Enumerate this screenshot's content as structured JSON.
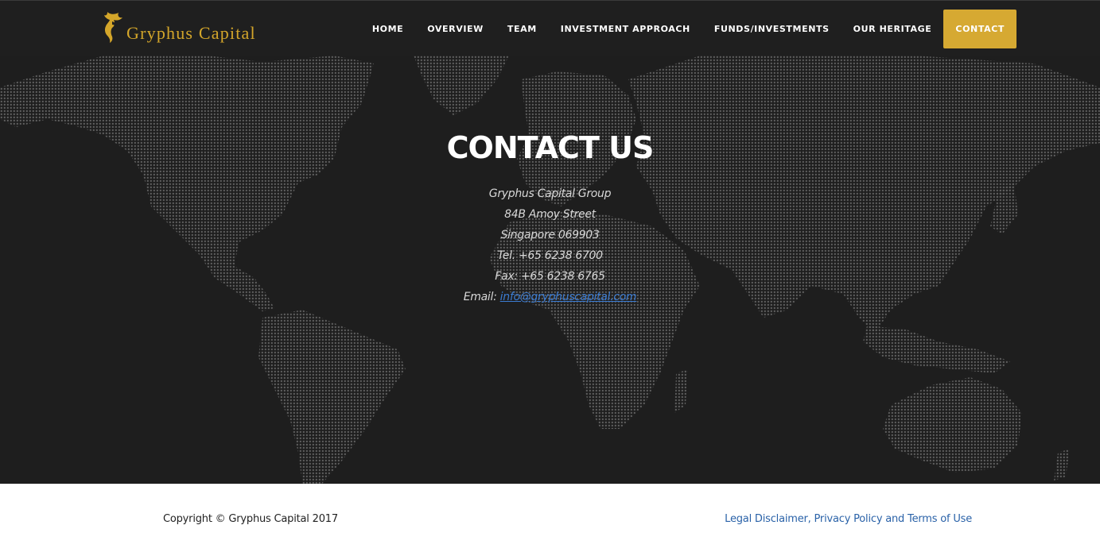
{
  "brand": {
    "name": "Gryphus Capital",
    "color": "#d4a62a"
  },
  "nav": {
    "items": [
      {
        "label": "HOME"
      },
      {
        "label": "OVERVIEW"
      },
      {
        "label": "TEAM"
      },
      {
        "label": "INVESTMENT APPROACH"
      },
      {
        "label": "FUNDS/INVESTMENTS"
      },
      {
        "label": "OUR HERITAGE"
      },
      {
        "label": "CONTACT"
      }
    ],
    "active_index": 6,
    "active_color": "#d6a932"
  },
  "hero": {
    "title": "CONTACT US",
    "address_lines": [
      "Gryphus Capital Group",
      "84B Amoy Street",
      "Singapore 069903",
      "Tel. +65 6238 6700",
      "Fax: +65 6238 6765"
    ],
    "email_label": "Email:",
    "email": "info@gryphuscapital.com",
    "background_image": "world-map-dots",
    "background_color": "#1e1e1e"
  },
  "footer": {
    "copyright": "Copyright © Gryphus Capital 2017",
    "legal_link": "Legal Disclaimer, Privacy Policy and Terms of Use",
    "link_color": "#2a62a8"
  }
}
